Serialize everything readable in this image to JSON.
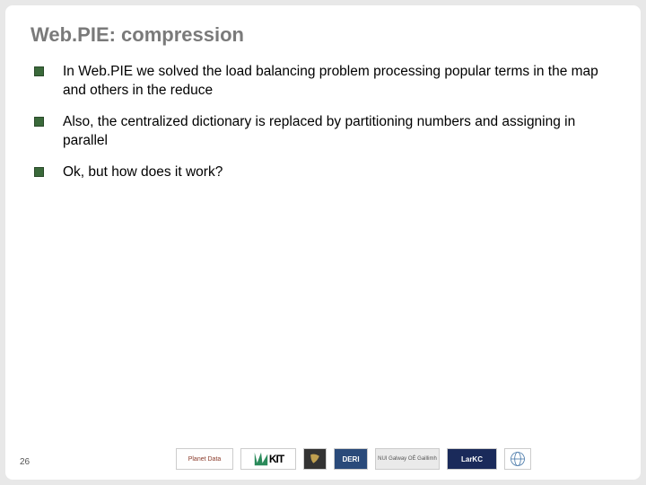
{
  "title": "Web.PIE: compression",
  "bullets": [
    "In Web.PIE we solved the load balancing problem processing popular terms in the map and others in the reduce",
    "Also, the centralized dictionary is replaced by partitioning numbers and assigning in parallel",
    "Ok, but how does it work?"
  ],
  "page_number": "26",
  "logos": {
    "planetdata": "Planet Data",
    "kit": "KIT",
    "deri": "DERI",
    "nuig": "NUI Galway OÉ Gaillimh",
    "larkc": "LarKC"
  }
}
